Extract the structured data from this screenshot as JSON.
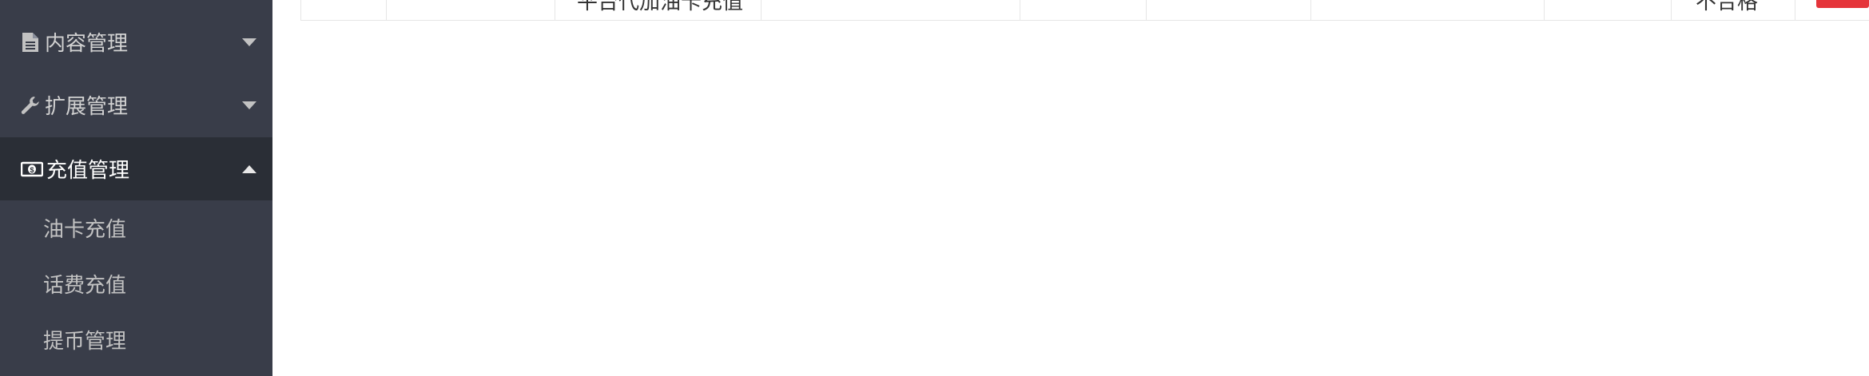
{
  "sidebar": {
    "menus": [
      {
        "label": "内容管理",
        "icon": "file-icon",
        "expanded": false
      },
      {
        "label": "扩展管理",
        "icon": "wrench-icon",
        "expanded": false
      },
      {
        "label": "充值管理",
        "icon": "money-icon",
        "expanded": true
      }
    ],
    "sub_items": [
      {
        "label": "油卡充值"
      },
      {
        "label": "话费充值"
      },
      {
        "label": "提币管理"
      }
    ]
  },
  "table": {
    "partial_cells": [
      "平台代加油卡充值",
      "不合格"
    ],
    "delete_button_color": "#e5343a"
  },
  "colors": {
    "sidebar_bg": "#393d49",
    "sidebar_active_bg": "#2a2e36"
  }
}
